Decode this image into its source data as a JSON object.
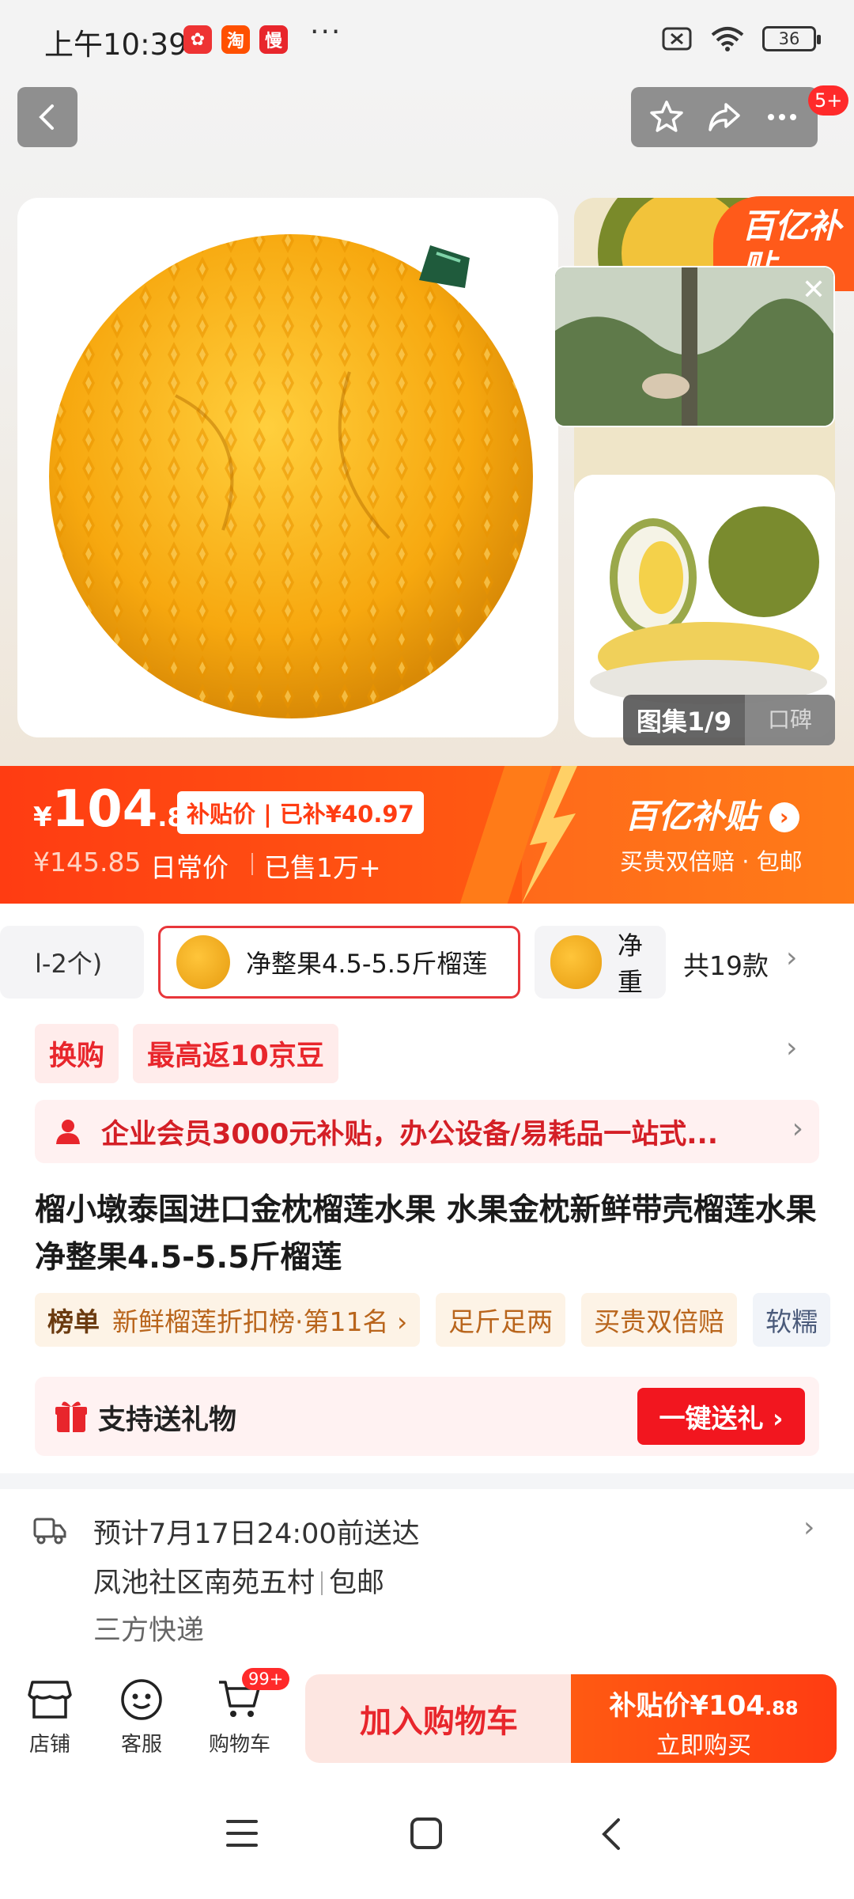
{
  "status_bar": {
    "time": "上午10:39",
    "apps": [
      "淘",
      "慢"
    ],
    "dots": "···",
    "battery": "36"
  },
  "gallery": {
    "cart_badge": "5+",
    "subsidy_corner": "百亿补贴",
    "album_label": "图集1/9",
    "reviews_label": "口碑"
  },
  "price": {
    "currency": "¥",
    "integer": "104",
    "decimal": ".88",
    "subsidy_tag": "补贴价 | 已补¥40.97",
    "original": "¥145.85",
    "original_label": "日常价",
    "sold": "已售1万+",
    "banner_title": "百亿补贴",
    "banner_sub": "买贵双倍赔 · 包邮"
  },
  "variants": {
    "left_chip": "l-2个)",
    "selected": "净整果4.5-5.5斤榴莲",
    "next_chip": "净重",
    "count": "共19款"
  },
  "promos": [
    "换购",
    "最高返10京豆"
  ],
  "enterprise": "企业会员3000元补贴，办公设备/易耗品一站式...",
  "title": "榴小墩泰国进口金枕榴莲水果 水果金枕新鲜带壳榴莲水果 净整果4.5-5.5斤榴莲",
  "rank": {
    "label": "榜单",
    "text": "新鲜榴莲折扣榜·第11名 ›",
    "tags": [
      "足斤足两",
      "买贵双倍赔",
      "软糯"
    ]
  },
  "gift": {
    "label": "支持送礼物",
    "button": "一键送礼 ›"
  },
  "delivery": {
    "eta": "预计7月17日24:00前送达",
    "address": "凤池社区南苑五村",
    "shipping": "包邮",
    "courier": "三方快递"
  },
  "bottom_bar": {
    "store": "店铺",
    "service": "客服",
    "cart": "购物车",
    "cart_badge": "99+",
    "add_to_cart": "加入购物车",
    "buy_top": "补贴价¥104",
    "buy_top_dec": ".88",
    "buy_sub": "立即购买"
  },
  "colors": {
    "accent": "#ff3c12",
    "red": "#e8262c",
    "gold": "#b9651c"
  }
}
